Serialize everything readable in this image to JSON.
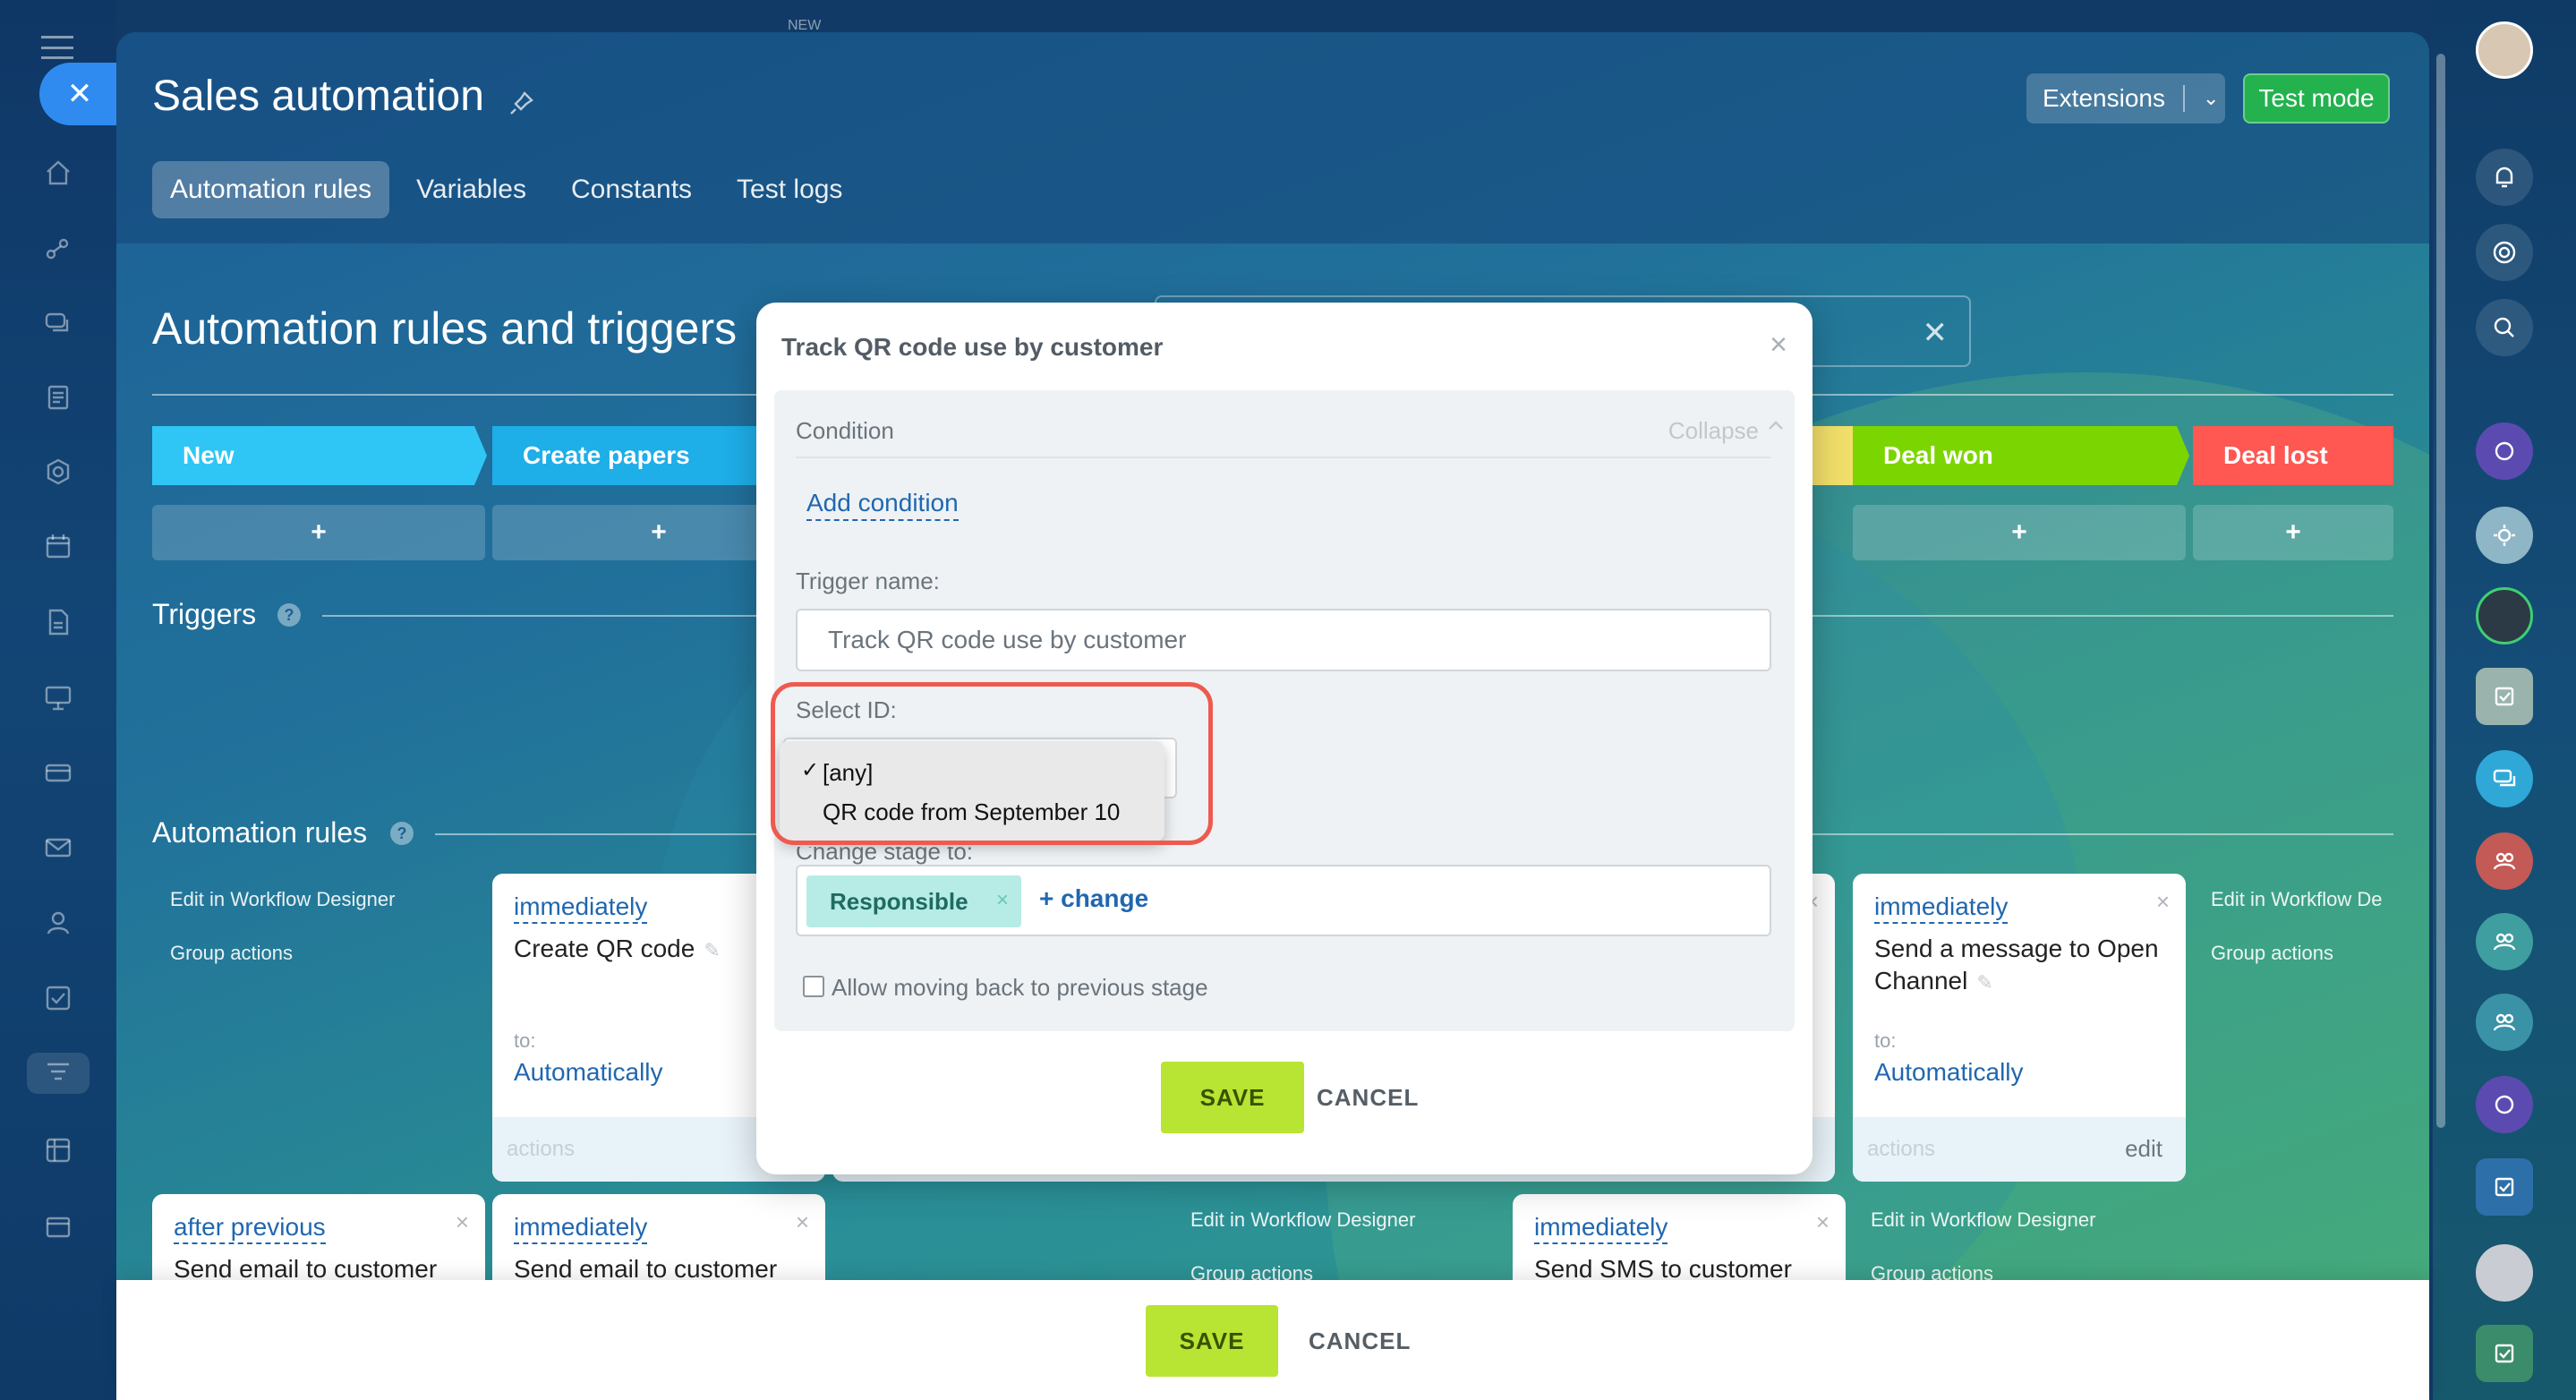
{
  "left_rail": {
    "icons": [
      "home-icon",
      "chart-icon",
      "chat-icon",
      "document-icon",
      "hexagon-icon",
      "calendar-icon",
      "file-icon",
      "presentation-icon",
      "card-icon",
      "mail-icon",
      "contacts-icon",
      "checkbox-icon",
      "funnel-icon",
      "grid-icon",
      "box-icon"
    ]
  },
  "right_rail": {
    "icons": [
      "avatar",
      "bell-icon",
      "target-icon",
      "chat-search-icon",
      "channel-icon",
      "gear-avatar",
      "user-avatar",
      "task-icon",
      "chat-bubbles-icon",
      "group-icon",
      "group-icon",
      "group-icon",
      "channel-icon",
      "task-icon",
      "user-avatar",
      "task-icon"
    ]
  },
  "header": {
    "new_label": "NEW",
    "title": "Sales automation",
    "tabs": [
      "Automation rules",
      "Variables",
      "Constants",
      "Test logs"
    ],
    "active_tab": 0,
    "extensions_label": "Extensions",
    "test_mode_label": "Test mode"
  },
  "section": {
    "title": "Automation rules and triggers",
    "triggers_label": "Triggers",
    "rules_label": "Automation rules"
  },
  "stages": [
    {
      "name": "New",
      "color": "#2fc6f6"
    },
    {
      "name": "Create papers",
      "color": "#1eaee8"
    },
    {
      "name": "Deal won",
      "color": "#7bd500"
    },
    {
      "name": "Deal lost",
      "color": "#ff5752"
    }
  ],
  "stage_add_label": "+",
  "side_links": {
    "edit_designer": "Edit in Workflow Designer",
    "edit_designer_trunc": "Edit in Workflow De",
    "group_actions": "Group actions"
  },
  "cards": {
    "c1": {
      "delay": "immediately",
      "title": "Create QR code",
      "to": "to:",
      "resp": "Automatically",
      "foot": "actions"
    },
    "c2": {
      "delay": "immediately",
      "title": "Send a message to Open Channel",
      "to": "to:",
      "resp": "Automatically",
      "foot": "actions",
      "edit": "edit"
    },
    "c3": {
      "delay": "after previous",
      "title": "Send email to customer"
    },
    "c4": {
      "delay": "immediately",
      "title": "Send email to customer"
    },
    "c5": {
      "delay": "immediately",
      "title": "Send SMS to customer"
    },
    "frag_edit": "edit"
  },
  "bottom": {
    "save": "SAVE",
    "cancel": "CANCEL"
  },
  "modal": {
    "title": "Track QR code use by customer",
    "condition_label": "Condition",
    "collapse_label": "Collapse",
    "add_condition": "Add condition",
    "trigger_name_label": "Trigger name:",
    "trigger_name_value": "Track QR code use by customer",
    "select_id_label": "Select ID:",
    "dropdown_options": [
      "[any]",
      "QR code from September 10"
    ],
    "selected_option": "[any]",
    "check_mark": "✓",
    "change_stage_label": "Change stage to:",
    "responsible_chip": "Responsible",
    "change_link": "+ change",
    "allow_back_label": "Allow moving back to previous stage",
    "save": "SAVE",
    "cancel": "CANCEL"
  },
  "colors": {
    "accent_blue": "#2067b0",
    "save_green": "#b8e433",
    "test_mode_green": "#23b24e",
    "highlight_red": "#ee5a4f"
  }
}
